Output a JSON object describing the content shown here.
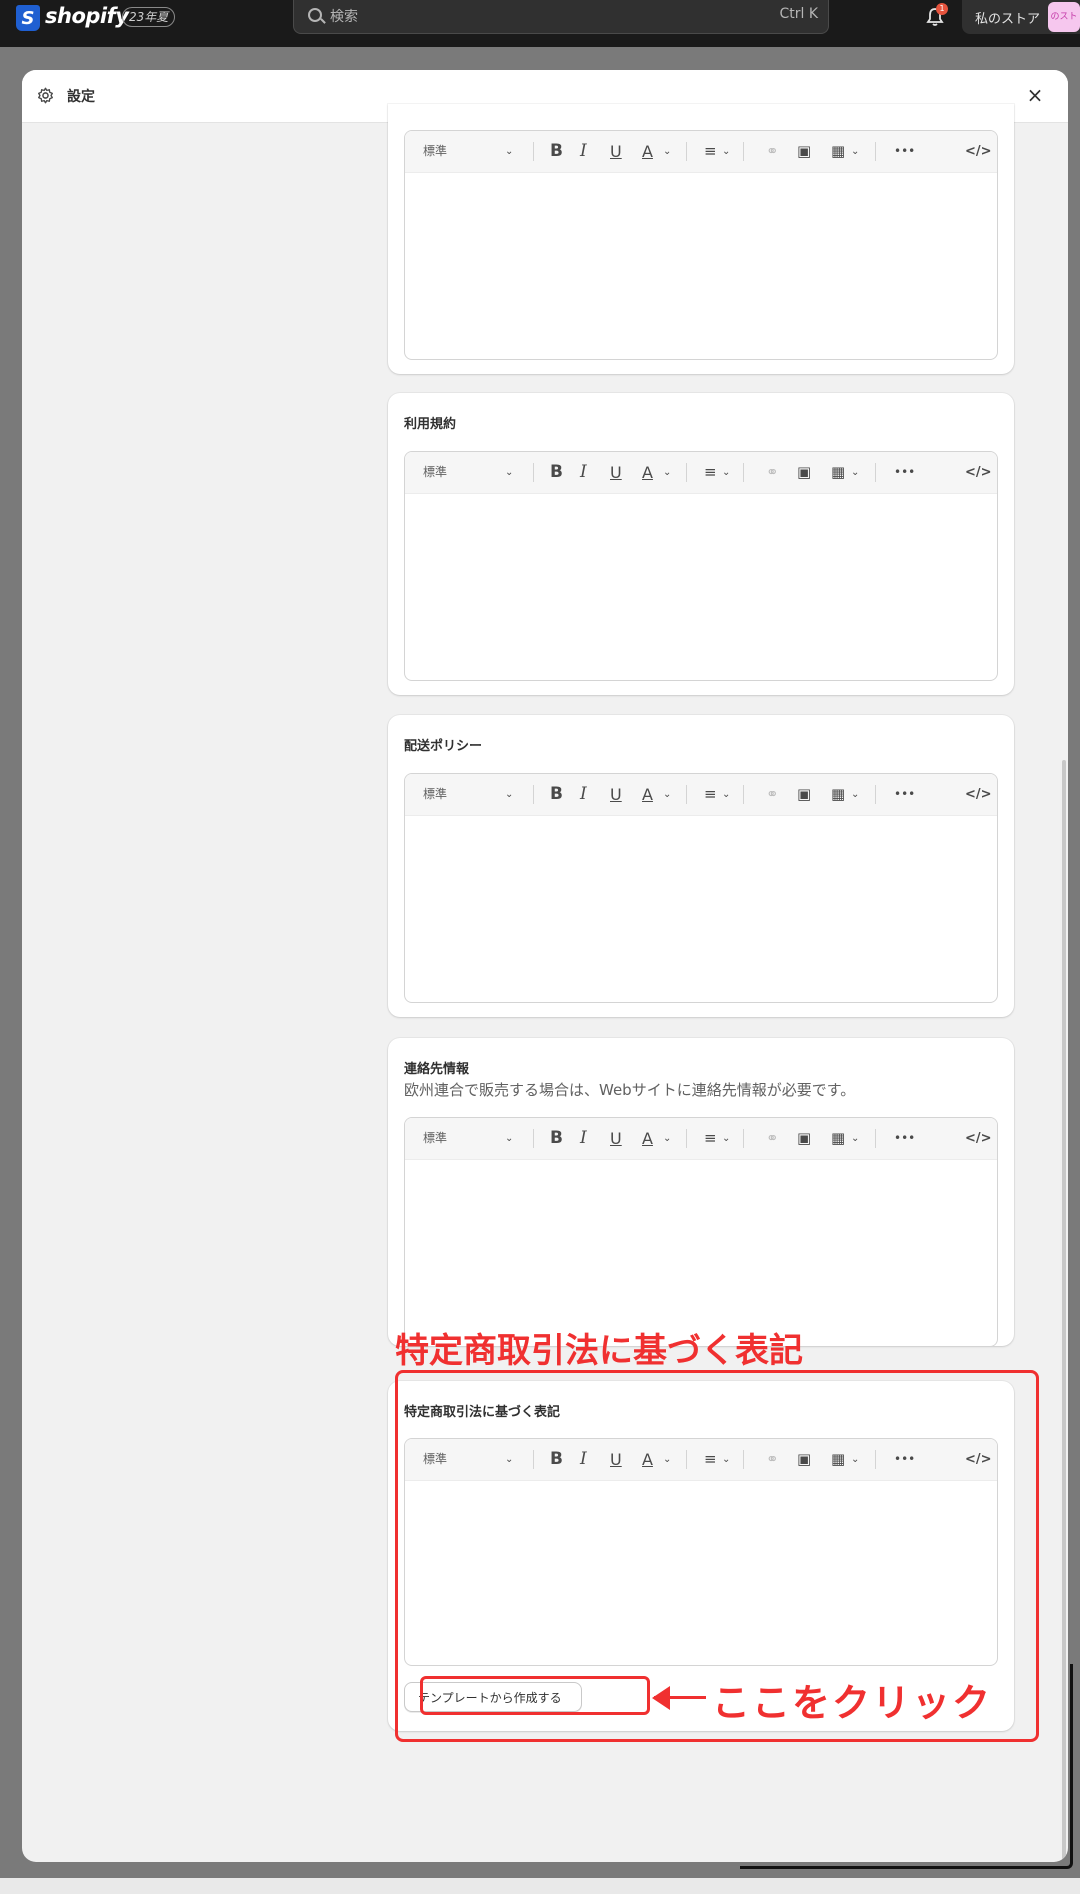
{
  "topbar": {
    "logo_text": "shopify",
    "logo_mark": "S",
    "edition_badge": "23年夏",
    "search_placeholder": "検索",
    "search_shortcut": "Ctrl K",
    "notification_count": "1",
    "store_name": "私のストア",
    "store_avatar_text": "のスト"
  },
  "modal": {
    "title": "設定",
    "close_label": "×"
  },
  "toolbar": {
    "style_select": "標準",
    "icons": [
      "chevron-down-icon",
      "bold-icon",
      "italic-icon",
      "underline-icon",
      "text-color-icon",
      "align-icon",
      "link-icon",
      "image-icon",
      "table-icon",
      "more-icon",
      "code-icon"
    ],
    "bold": "B",
    "italic": "I",
    "underline": "U",
    "color": "A",
    "more": "•••",
    "code": "</>"
  },
  "policies": [
    {
      "title": "",
      "description": ""
    },
    {
      "title": "利用規約",
      "description": ""
    },
    {
      "title": "配送ポリシー",
      "description": ""
    },
    {
      "title": "連絡先情報",
      "description": "欧州連合で販売する場合は、Webサイトに連絡先情報が必要です。"
    },
    {
      "title": "特定商取引法に基づく表記",
      "description": ""
    }
  ],
  "template_button": "テンプレートから作成する",
  "annotations": {
    "section_label": "特定商取引法に基づく表記",
    "click_here": "ここをクリック",
    "color": "#f03030"
  }
}
